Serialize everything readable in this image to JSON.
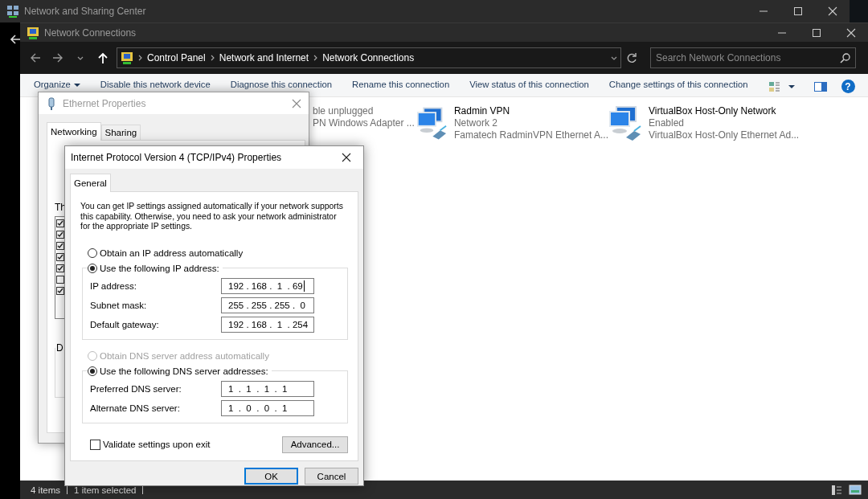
{
  "background_window": {
    "title": "Network and Sharing Center"
  },
  "window": {
    "title": "Network Connections",
    "breadcrumb": [
      "Control Panel",
      "Network and Internet",
      "Network Connections"
    ],
    "search": {
      "placeholder": "Search Network Connections"
    },
    "toolbar": [
      {
        "label": "Organize",
        "kind": "menu"
      },
      {
        "label": "Disable this network device",
        "kind": "command"
      },
      {
        "label": "Diagnose this connection",
        "kind": "command"
      },
      {
        "label": "Rename this connection",
        "kind": "command"
      },
      {
        "label": "View status of this connection",
        "kind": "command"
      },
      {
        "label": "Change settings of this connection",
        "kind": "command"
      }
    ],
    "help": {
      "label": "?"
    },
    "connections": [
      {
        "kind": "covered",
        "status": "ble unplugged",
        "adapter": "PN Windows Adapter ..."
      },
      {
        "kind": "shown",
        "name": "Radmin VPN",
        "status": "Network 2",
        "adapter": "Famatech RadminVPN Ethernet A..."
      },
      {
        "kind": "shown",
        "name": "VirtualBox Host-Only Network",
        "status": "Enabled",
        "adapter": "VirtualBox Host-Only Ethernet Ad..."
      }
    ],
    "status_bar": [
      "4 items",
      "1 item selected"
    ]
  },
  "ethernet_dialog": {
    "title": "Ethernet Properties",
    "tabs": [
      {
        "label": "Networking",
        "selected": true
      },
      {
        "label": "Sharing",
        "selected": false
      }
    ],
    "list_label": "Th",
    "items": [
      {
        "checked": true
      },
      {
        "checked": true
      },
      {
        "checked": true
      },
      {
        "checked": true
      },
      {
        "checked": true
      },
      {
        "checked": false
      },
      {
        "checked": true
      }
    ],
    "group_label": "D"
  },
  "ipv4_dialog": {
    "title": "Internet Protocol Version 4 (TCP/IPv4) Properties",
    "tabs": [
      {
        "label": "General",
        "selected": true
      }
    ],
    "description": "You can get IP settings assigned automatically if your network supports this capability. Otherwise, you need to ask your network administrator for the appropriate IP settings.",
    "sections": [
      {
        "options": [
          {
            "label": "Obtain an IP address automatically",
            "selected": false,
            "disabled": false
          },
          {
            "label": "Use the following IP address:",
            "selected": true,
            "disabled": false
          }
        ],
        "fields": [
          {
            "label": "IP address:",
            "value": "192 . 168 .  1  . 69",
            "focused": true
          },
          {
            "label": "Subnet mask:",
            "value": "255 . 255 . 255 .  0",
            "focused": false
          },
          {
            "label": "Default gateway:",
            "value": "192 . 168 .  1  . 254",
            "focused": false
          }
        ]
      },
      {
        "options": [
          {
            "label": "Obtain DNS server address automatically",
            "selected": false,
            "disabled": true
          },
          {
            "label": "Use the following DNS server addresses:",
            "selected": true,
            "disabled": false
          }
        ],
        "fields": [
          {
            "label": "Preferred DNS server:",
            "value": "1  .  1  .  1  .  1",
            "focused": false
          },
          {
            "label": "Alternate DNS server:",
            "value": "1  .  0  .  0  .  1",
            "focused": false
          }
        ]
      }
    ],
    "validate": {
      "label": "Validate settings upon exit",
      "checked": false
    },
    "advanced": {
      "label": "Advanced..."
    },
    "buttons": [
      {
        "label": "OK",
        "focused": true
      },
      {
        "label": "Cancel",
        "focused": false
      }
    ]
  }
}
